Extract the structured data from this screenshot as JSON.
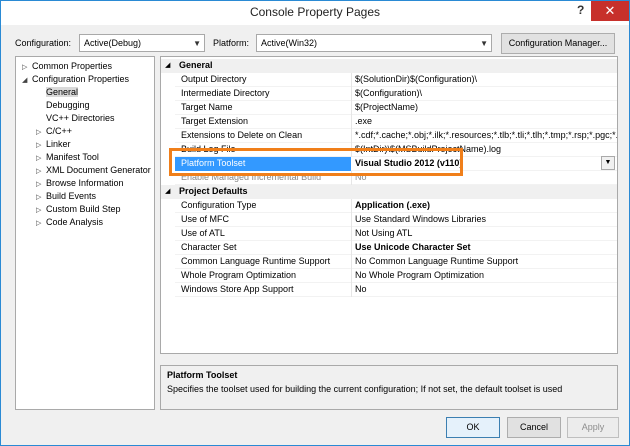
{
  "window": {
    "title": "Console Property Pages",
    "help": "?",
    "close": "✕"
  },
  "toolbar": {
    "config_label": "Configuration:",
    "config_value": "Active(Debug)",
    "platform_label": "Platform:",
    "platform_value": "Active(Win32)",
    "config_manager": "Configuration Manager..."
  },
  "tree": {
    "common": "Common Properties",
    "config_props": "Configuration Properties",
    "items": [
      "General",
      "Debugging",
      "VC++ Directories",
      "C/C++",
      "Linker",
      "Manifest Tool",
      "XML Document Generator",
      "Browse Information",
      "Build Events",
      "Custom Build Step",
      "Code Analysis"
    ]
  },
  "grid": {
    "general_title": "General",
    "general_rows": [
      {
        "name": "Output Directory",
        "value": "$(SolutionDir)$(Configuration)\\"
      },
      {
        "name": "Intermediate Directory",
        "value": "$(Configuration)\\"
      },
      {
        "name": "Target Name",
        "value": "$(ProjectName)"
      },
      {
        "name": "Target Extension",
        "value": ".exe"
      },
      {
        "name": "Extensions to Delete on Clean",
        "value": "*.cdf;*.cache;*.obj;*.ilk;*.resources;*.tlb;*.tli;*.tlh;*.tmp;*.rsp;*.pgc;*.pgd;"
      },
      {
        "name": "Build Log File",
        "value": "$(IntDir)\\$(MSBuildProjectName).log"
      },
      {
        "name": "Platform Toolset",
        "value": "Visual Studio 2012 (v110)"
      },
      {
        "name": "Enable Managed Incremental Build",
        "value": "No"
      }
    ],
    "defaults_title": "Project Defaults",
    "defaults_rows": [
      {
        "name": "Configuration Type",
        "value": "Application (.exe)"
      },
      {
        "name": "Use of MFC",
        "value": "Use Standard Windows Libraries"
      },
      {
        "name": "Use of ATL",
        "value": "Not Using ATL"
      },
      {
        "name": "Character Set",
        "value": "Use Unicode Character Set"
      },
      {
        "name": "Common Language Runtime Support",
        "value": "No Common Language Runtime Support"
      },
      {
        "name": "Whole Program Optimization",
        "value": "No Whole Program Optimization"
      },
      {
        "name": "Windows Store App Support",
        "value": "No"
      }
    ]
  },
  "description": {
    "title": "Platform Toolset",
    "text": "Specifies the toolset used for building the current configuration; If not set, the default toolset is used"
  },
  "buttons": {
    "ok": "OK",
    "cancel": "Cancel",
    "apply": "Apply"
  },
  "colors": {
    "accent": "#3399ff",
    "highlight": "#f07f1a",
    "close": "#c7302b"
  }
}
